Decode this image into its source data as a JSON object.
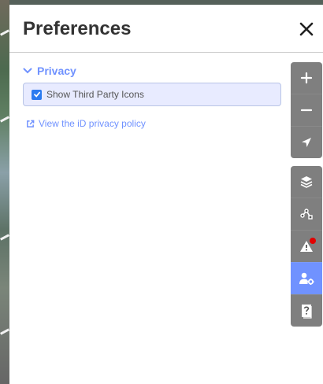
{
  "panel": {
    "title": "Preferences"
  },
  "section": {
    "title": "Privacy"
  },
  "options": [
    {
      "label": "Show Third Party Icons",
      "checked": true
    }
  ],
  "link": {
    "label": "View the iD privacy policy"
  },
  "map_controls": {
    "zoom_in": "plus-icon",
    "zoom_out": "minus-icon",
    "geolocate": "location-arrow-icon",
    "panes": [
      "layers-icon",
      "data-nodes-icon",
      "issues-icon",
      "preferences-icon",
      "help-icon"
    ],
    "active_pane": "preferences-icon"
  },
  "colors": {
    "accent": "#7092ff",
    "issue_dot": "#e20000",
    "checkbox": "#2b7bf0"
  }
}
